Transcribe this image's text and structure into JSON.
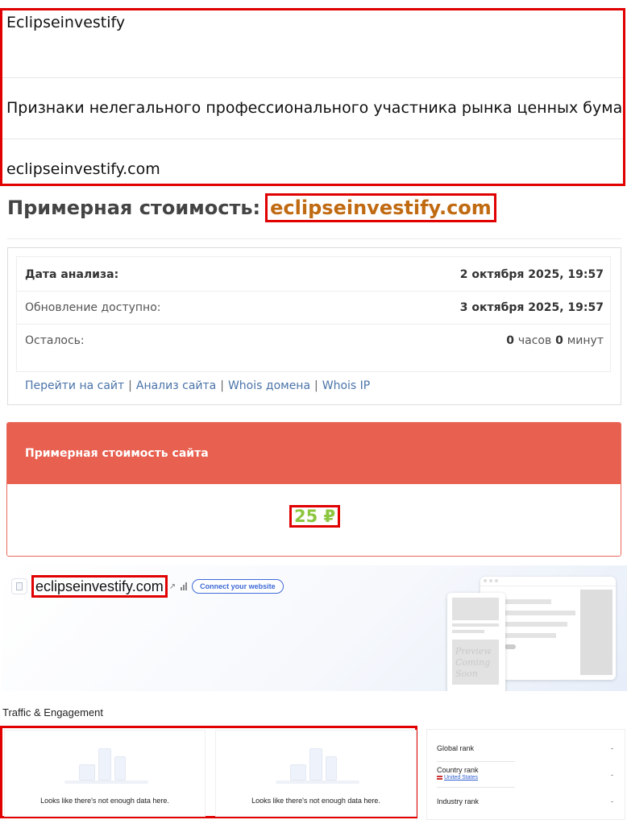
{
  "info": {
    "brand": "Eclipseinvestify",
    "warning": "Признаки нелегального профессионального участника рынка ценных бумаг",
    "domain": "eclipseinvestify.com"
  },
  "heading": {
    "prefix": "Примерная стоимость:",
    "domain": "eclipseinvestify.com"
  },
  "analysis": {
    "rows": [
      {
        "label": "Дата анализа:",
        "value": "2 октября 2025, 19:57"
      },
      {
        "label": "Обновление доступно:",
        "value": "3 октября 2025, 19:57"
      },
      {
        "label": "Осталось:",
        "hours": "0",
        "hours_unit": "часов",
        "minutes": "0",
        "minutes_unit": "минут"
      }
    ],
    "links": [
      "Перейти на сайт",
      "Анализ сайта",
      "Whois домена",
      "Whois IP"
    ],
    "link_separator": "|"
  },
  "estimate": {
    "title": "Примерная стоимость сайта",
    "amount": "25 ₽",
    "header_color": "#e86050",
    "amount_color": "#8cc63f"
  },
  "similarweb": {
    "domain": "eclipseinvestify.com",
    "connect_label": "Connect your website",
    "preview_text_1": "Preview",
    "preview_text_2": "Coming Soon",
    "section_title": "Traffic & Engagement",
    "nodata_text": "Looks like there's not enough data here.",
    "ranks": {
      "global_label": "Global rank",
      "global_value": "-",
      "country_label": "Country rank",
      "country_link": "United States",
      "country_value": "-",
      "industry_label": "Industry rank",
      "industry_value": "-"
    },
    "accent_color": "#3d6ad6"
  }
}
